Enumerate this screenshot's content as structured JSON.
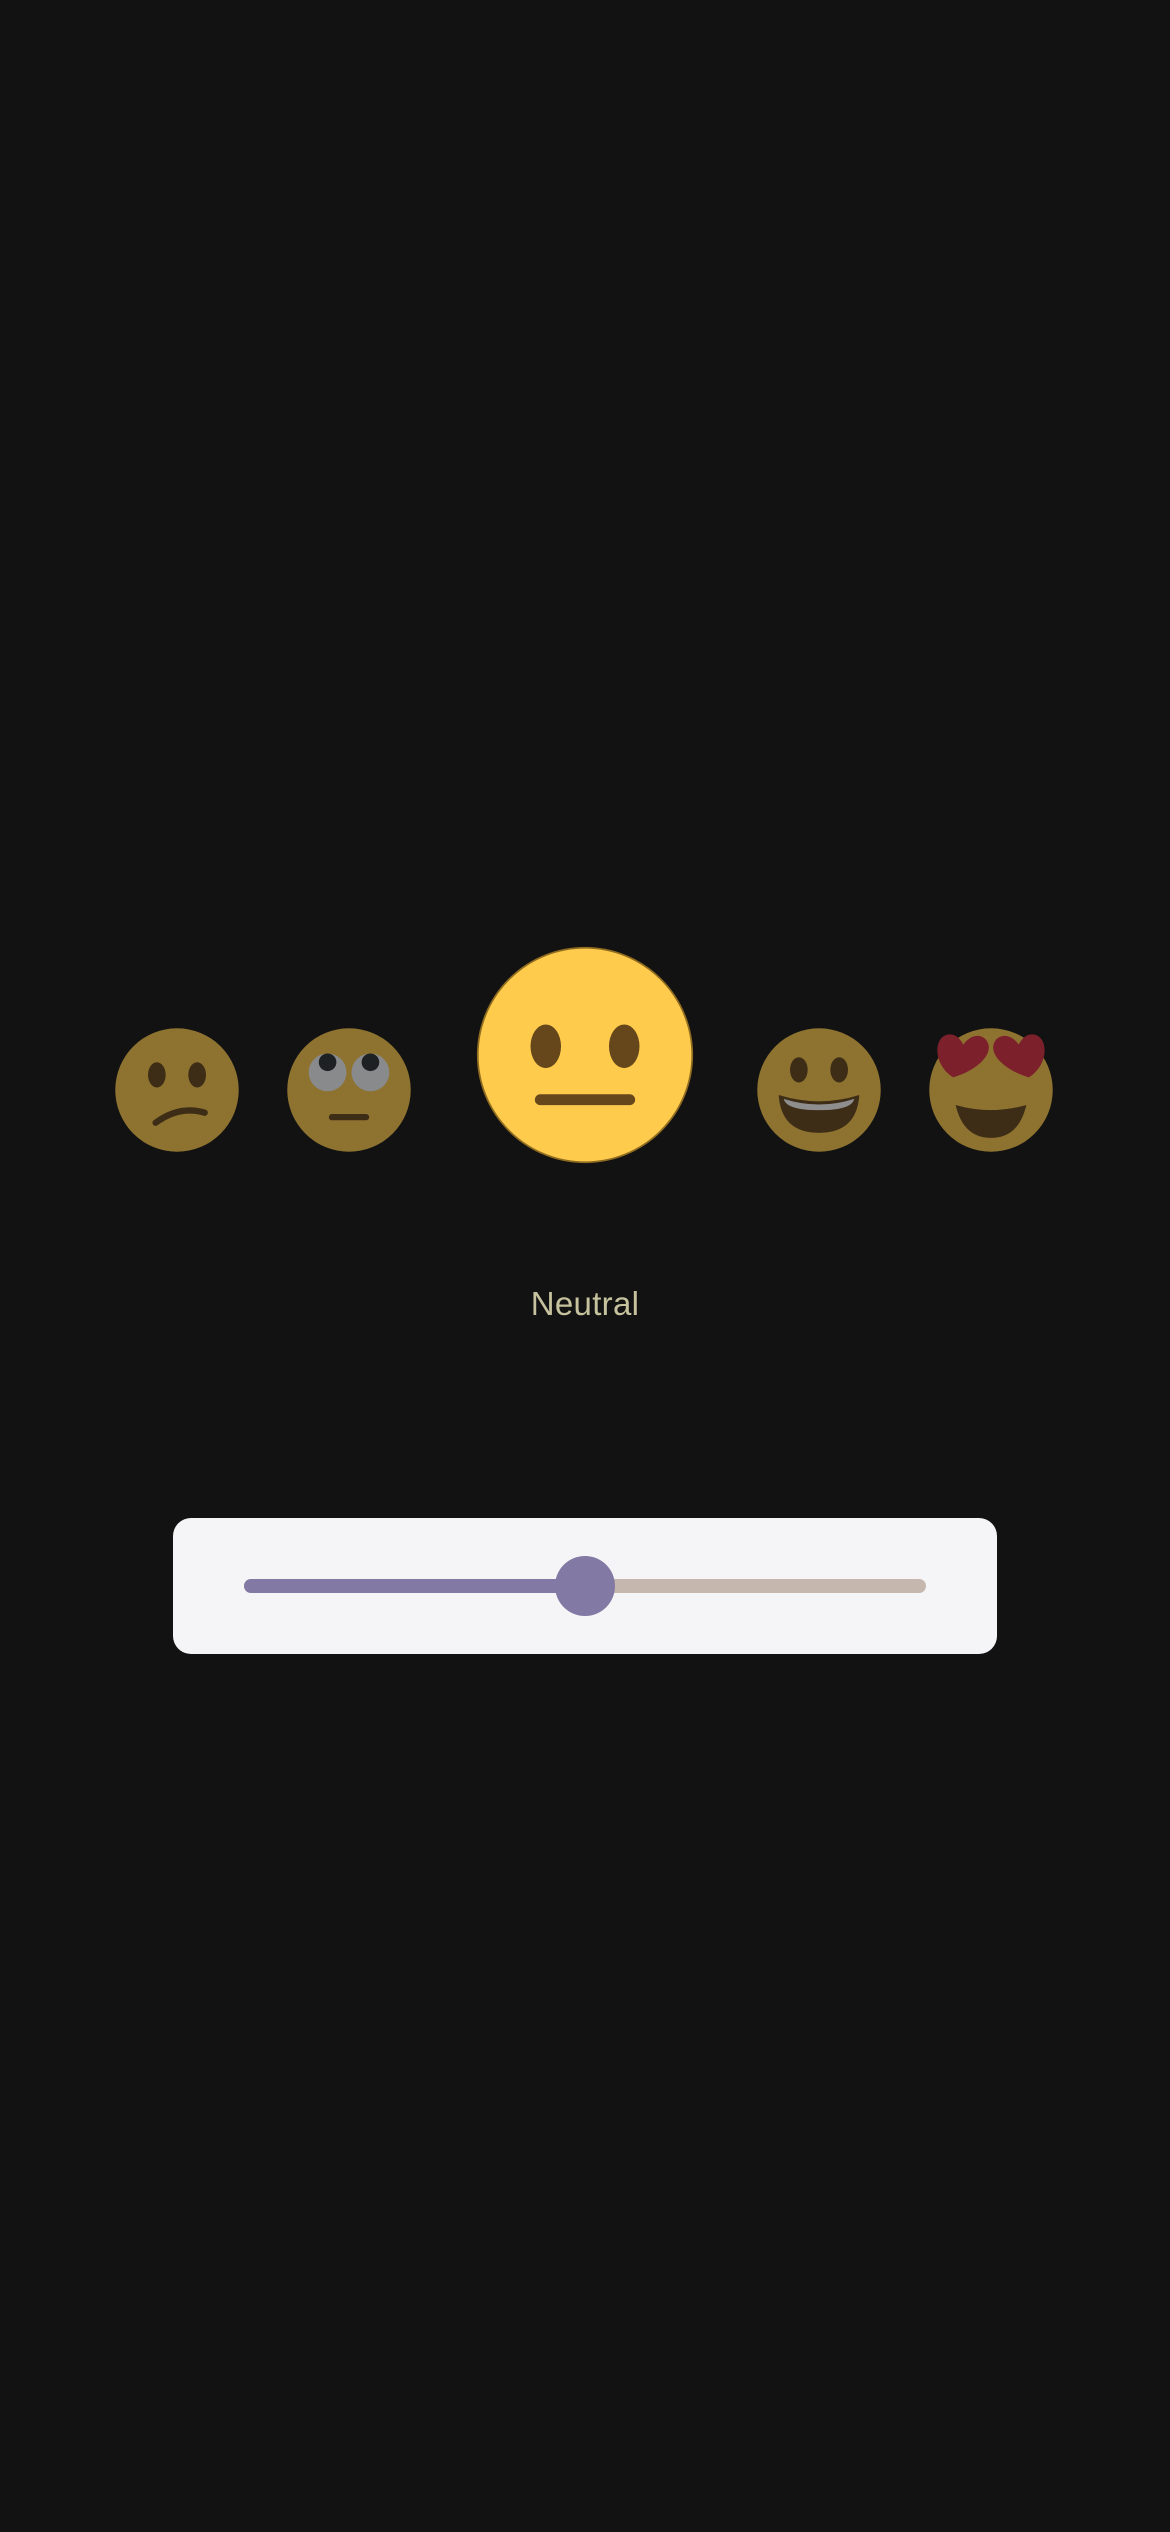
{
  "mood_picker": {
    "emojis": [
      {
        "icon": "confused-face-icon",
        "selected": false
      },
      {
        "icon": "rolling-eyes-face-icon",
        "selected": false
      },
      {
        "icon": "neutral-face-icon",
        "selected": true
      },
      {
        "icon": "grinning-face-icon",
        "selected": false
      },
      {
        "icon": "heart-eyes-face-icon",
        "selected": false
      }
    ],
    "selected_label": "Neutral"
  },
  "slider": {
    "value": 0.5,
    "active_color": "#827aa4",
    "inactive_color": "#c6b7ae",
    "card_color": "#f5f4f7"
  },
  "colors": {
    "background": "#121212",
    "emoji_face": "#ffcb4c",
    "label_text": "#c5c29d"
  }
}
